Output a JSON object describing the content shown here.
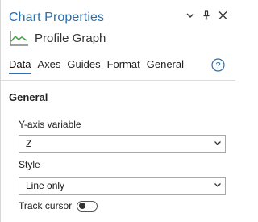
{
  "header": {
    "title": "Chart Properties",
    "subtitle": "Profile Graph",
    "controls": [
      {
        "name": "chevron-down-icon",
        "glyph": "⌄"
      },
      {
        "name": "pin-icon",
        "glyph": "⊥"
      },
      {
        "name": "close-icon",
        "glyph": "✕"
      }
    ]
  },
  "tabs": [
    {
      "label": "Data",
      "active": true
    },
    {
      "label": "Axes",
      "active": false
    },
    {
      "label": "Guides",
      "active": false
    },
    {
      "label": "Format",
      "active": false
    },
    {
      "label": "General",
      "active": false
    }
  ],
  "help": {
    "glyph": "?",
    "icon": "help-icon"
  },
  "section": {
    "title": "General"
  },
  "fields": {
    "y_axis": {
      "label": "Y-axis variable",
      "value": "Z"
    },
    "style": {
      "label": "Style",
      "value": "Line only"
    },
    "track_cursor": {
      "label": "Track cursor",
      "on": false
    }
  },
  "colors": {
    "accent": "#2a6fb0",
    "graph_icon": "#4aa34a"
  }
}
